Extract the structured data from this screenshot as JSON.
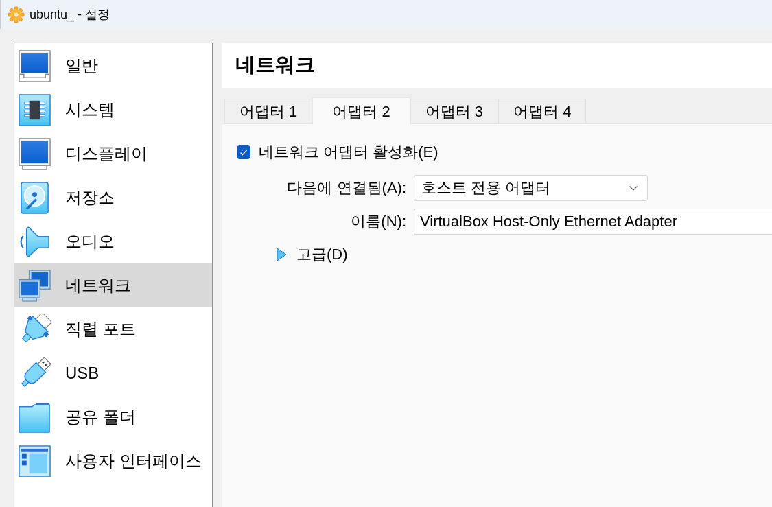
{
  "window": {
    "title": "ubuntu_ - 설정"
  },
  "sidebar": {
    "items": [
      {
        "label": "일반",
        "selected": false
      },
      {
        "label": "시스템",
        "selected": false
      },
      {
        "label": "디스플레이",
        "selected": false
      },
      {
        "label": "저장소",
        "selected": false
      },
      {
        "label": "오디오",
        "selected": false
      },
      {
        "label": "네트워크",
        "selected": true
      },
      {
        "label": "직렬 포트",
        "selected": false
      },
      {
        "label": "USB",
        "selected": false
      },
      {
        "label": "공유 폴더",
        "selected": false
      },
      {
        "label": "사용자 인터페이스",
        "selected": false
      }
    ]
  },
  "page": {
    "title": "네트워크"
  },
  "tabs": [
    {
      "label": "어댑터 1",
      "selected": false
    },
    {
      "label": "어댑터 2",
      "selected": true
    },
    {
      "label": "어댑터 3",
      "selected": false
    },
    {
      "label": "어댑터 4",
      "selected": false
    }
  ],
  "adapter": {
    "enable": {
      "label": "네트워크 어댑터 활성화(E)",
      "checked": true
    },
    "attached_to": {
      "label": "다음에 연결됨(A):",
      "value": "호스트 전용 어댑터"
    },
    "name": {
      "label": "이름(N):",
      "value": "VirtualBox Host-Only Ethernet Adapter"
    },
    "advanced": {
      "label": "고급(D)",
      "expanded": false
    }
  }
}
